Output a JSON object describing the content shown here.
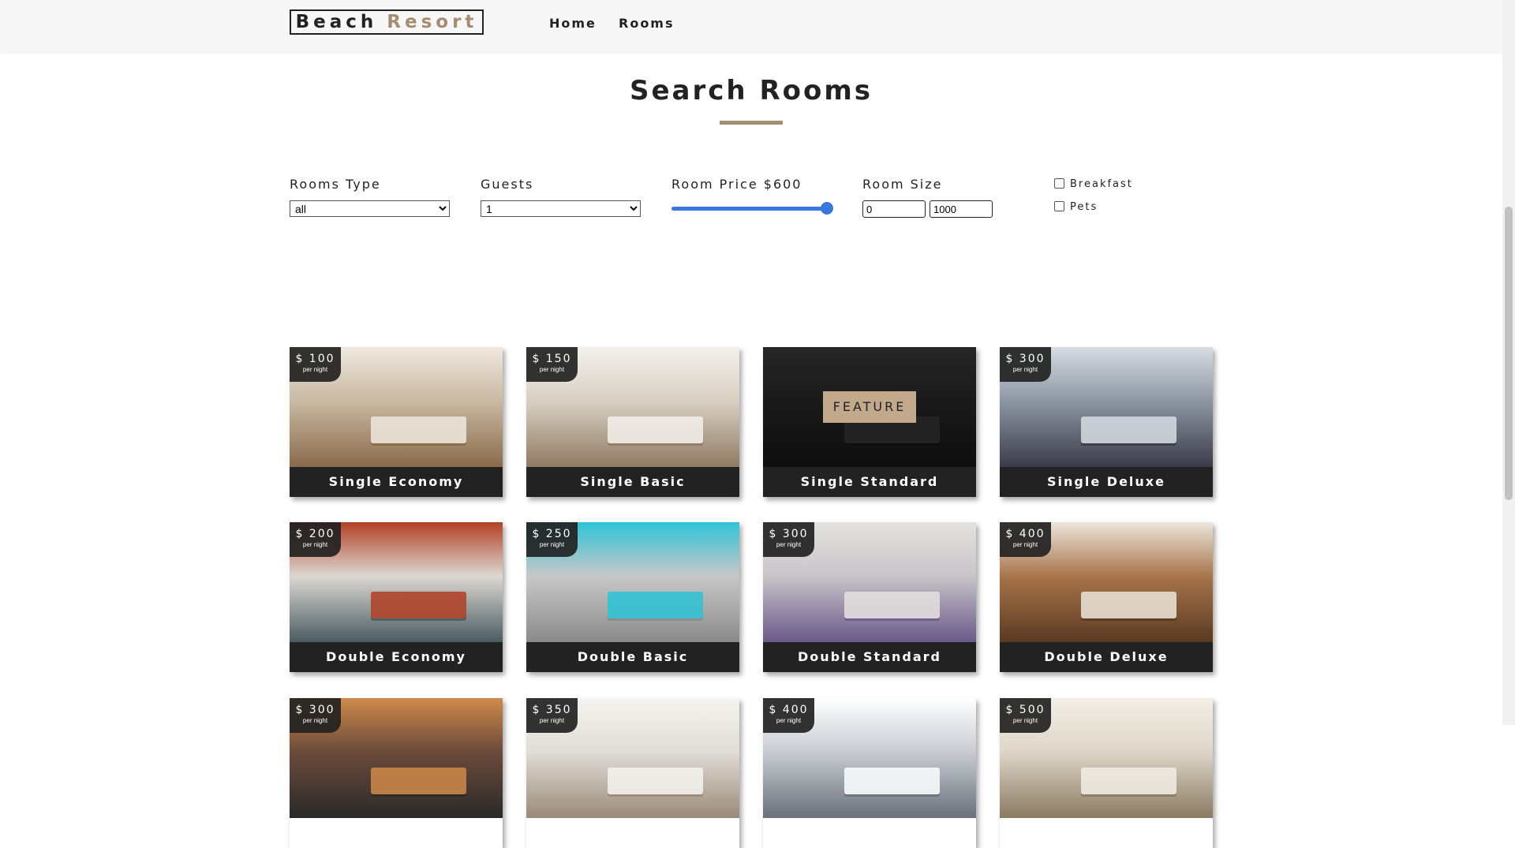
{
  "brand": {
    "part1": "Beach",
    "part2": "Resort"
  },
  "nav": {
    "home": "Home",
    "rooms": "Rooms"
  },
  "search": {
    "title": "Search Rooms",
    "rooms_type_label": "Rooms Type",
    "rooms_type_value": "all",
    "guests_label": "Guests",
    "guests_value": "1",
    "price_label": "Room Price $600",
    "price_fraction": 1.0,
    "size_label": "Room Size",
    "size_min": "0",
    "size_max": "1000",
    "breakfast_label": "Breakfast",
    "pets_label": "Pets"
  },
  "rooms": [
    {
      "name": "Single Economy",
      "price": "$ 100",
      "per": "per night"
    },
    {
      "name": "Single Basic",
      "price": "$ 150",
      "per": "per night"
    },
    {
      "name": "Single Standard",
      "feature_label": "FEATURE"
    },
    {
      "name": "Single Deluxe",
      "price": "$ 300",
      "per": "per night"
    },
    {
      "name": "Double Economy",
      "price": "$ 200",
      "per": "per night"
    },
    {
      "name": "Double Basic",
      "price": "$ 250",
      "per": "per night"
    },
    {
      "name": "Double Standard",
      "price": "$ 300",
      "per": "per night"
    },
    {
      "name": "Double Deluxe",
      "price": "$ 400",
      "per": "per night"
    },
    {
      "price": "$ 300",
      "per": "per night"
    },
    {
      "price": "$ 350",
      "per": "per night"
    },
    {
      "price": "$ 400",
      "per": "per night"
    },
    {
      "price": "$ 500",
      "per": "per night"
    }
  ],
  "colors": {
    "accent": "#a58d72",
    "slider": "#3a76e0",
    "dark": "#222222"
  }
}
